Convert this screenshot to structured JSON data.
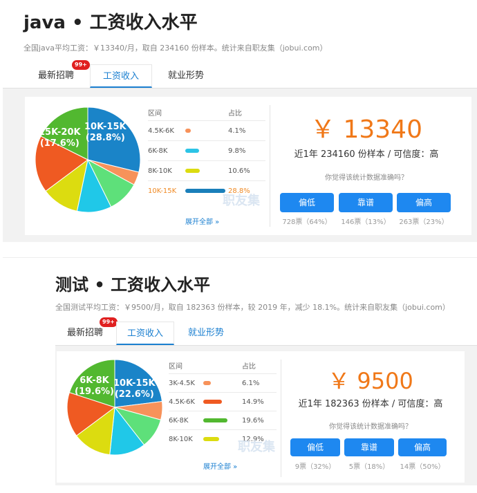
{
  "sections": [
    {
      "title": "java • 工资收入水平",
      "subtitle": "全国java平均工资：￥13340/月，取自 234160 份样本。统计来自职友集（jobui.com）",
      "tabs": [
        "最新招聘",
        "工资收入",
        "就业形势"
      ],
      "badge": "99+",
      "pie_labels": [
        {
          "text": "15K-20K\n(17.6%)",
          "line1": "15K-20K",
          "line2": "(17.6%)"
        },
        {
          "text": "10K-15K\n(28.8%)",
          "line1": "10K-15K",
          "line2": "(28.8%)"
        }
      ],
      "dist_header": {
        "range": "区间",
        "pct": "占比"
      },
      "dist": [
        {
          "range": "4.5K-6K",
          "pct": "4.1%",
          "color": "#f7925a"
        },
        {
          "range": "6K-8K",
          "pct": "9.8%",
          "color": "#2cc4e6"
        },
        {
          "range": "8K-10K",
          "pct": "10.6%",
          "color": "#dcdc10"
        },
        {
          "range": "10K-15K",
          "pct": "28.8%",
          "color": "#1a7fba"
        }
      ],
      "expand": "展开全部 »",
      "watermark": "职友集",
      "salary": "￥ 13340",
      "sample": "近1年 234160 份样本 / 可信度：高",
      "question": "你觉得该统计数据准确吗？",
      "votes": [
        {
          "label": "偏低",
          "count": "728票（64%）"
        },
        {
          "label": "靠谱",
          "count": "146票（13%）"
        },
        {
          "label": "偏高",
          "count": "263票（23%）"
        }
      ],
      "pie_slices": [
        {
          "pct": 28.8,
          "color": "#1a84c8"
        },
        {
          "pct": 4.1,
          "color": "#f7925a"
        },
        {
          "pct": 9.8,
          "color": "#5ee07a"
        },
        {
          "pct": 10.6,
          "color": "#20c8e8"
        },
        {
          "pct": 11.5,
          "color": "#dcdc10"
        },
        {
          "pct": 17.6,
          "color": "#ef5a22"
        },
        {
          "pct": 17.6,
          "color": "#52b830"
        }
      ]
    },
    {
      "title": "测试 • 工资收入水平",
      "subtitle": "全国测试平均工资：￥9500/月，取自 182363 份样本，较 2019 年，减少 18.1%。统计来自职友集（jobui.com）",
      "tabs": [
        "最新招聘",
        "工资收入",
        "就业形势"
      ],
      "badge": "99+",
      "pie_labels": [
        {
          "text": "6K-8K\n(19.6%)",
          "line1": "6K-8K",
          "line2": "(19.6%)"
        },
        {
          "text": "10K-15K\n(22.6%)",
          "line1": "10K-15K",
          "line2": "(22.6%)"
        }
      ],
      "dist_header": {
        "range": "区间",
        "pct": "占比"
      },
      "dist": [
        {
          "range": "3K-4.5K",
          "pct": "6.1%",
          "color": "#f7925a"
        },
        {
          "range": "4.5K-6K",
          "pct": "14.9%",
          "color": "#ef5a22"
        },
        {
          "range": "6K-8K",
          "pct": "19.6%",
          "color": "#52b830"
        },
        {
          "range": "8K-10K",
          "pct": "12.9%",
          "color": "#dcdc10"
        }
      ],
      "expand": "展开全部 »",
      "watermark": "职友集",
      "salary": "￥ 9500",
      "sample": "近1年 182363 份样本 / 可信度：高",
      "question": "你觉得该统计数据准确吗？",
      "votes": [
        {
          "label": "偏低",
          "count": "9票（32%）"
        },
        {
          "label": "靠谱",
          "count": "5票（18%）"
        },
        {
          "label": "偏高",
          "count": "14票（50%）"
        }
      ],
      "pie_slices": [
        {
          "pct": 22.6,
          "color": "#1a84c8"
        },
        {
          "pct": 6.1,
          "color": "#f7925a"
        },
        {
          "pct": 10.0,
          "color": "#5ee07a"
        },
        {
          "pct": 12.0,
          "color": "#20c8e8"
        },
        {
          "pct": 12.9,
          "color": "#dcdc10"
        },
        {
          "pct": 14.9,
          "color": "#ef5a22"
        },
        {
          "pct": 19.6,
          "color": "#52b830"
        }
      ]
    }
  ]
}
